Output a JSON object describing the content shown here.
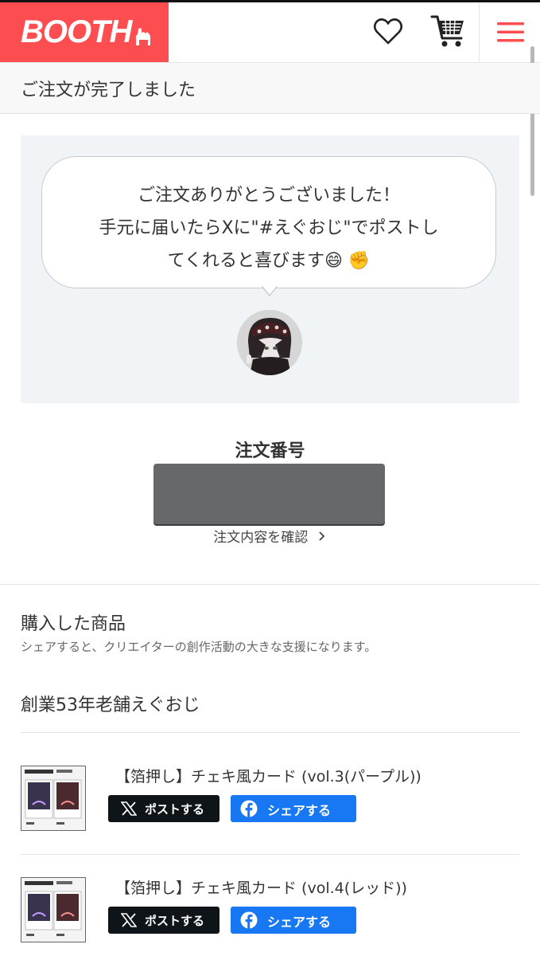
{
  "header": {
    "logo": "BOOTH",
    "icons": [
      "heart-icon",
      "cart-icon",
      "menu-icon"
    ],
    "brand_color": "#fc4d50"
  },
  "page_title": "ご注文が完了しました",
  "message": {
    "lines": [
      "ご注文ありがとうございました！",
      "手元に届いたらXに\"#えぐおじ\"でポストし",
      "てくれると喜びます😄 ✊"
    ]
  },
  "order": {
    "label": "注文番号",
    "link": "注文内容を確認"
  },
  "purchased": {
    "title": "購入した商品",
    "subtitle": "シェアすると、クリエイターの創作活動の大きな支援になります。",
    "shop_name": "創業53年老舗えぐおじ",
    "items": [
      {
        "title": "【箔押し】チェキ風カード (vol.3(パープル))",
        "post_label": "ポストする",
        "share_label": "シェアする"
      },
      {
        "title": "【箔押し】チェキ風カード (vol.4(レッド))",
        "post_label": "ポストする",
        "share_label": "シェアする"
      }
    ]
  },
  "colors": {
    "x_button": "#0f1419",
    "facebook_button": "#1877f2"
  }
}
